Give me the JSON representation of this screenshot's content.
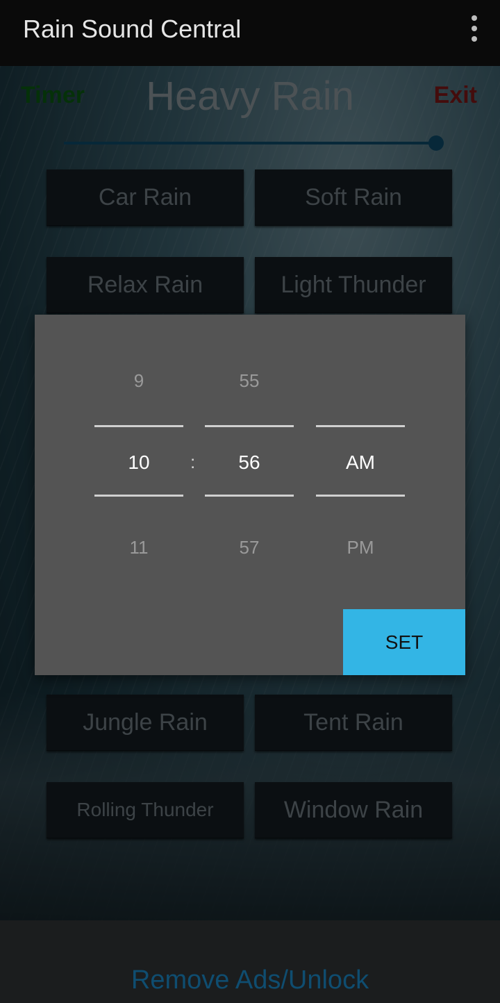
{
  "app_bar": {
    "title": "Rain Sound Central",
    "menu_icon": "more-vert-icon"
  },
  "player": {
    "timer_label": "Timer",
    "current_sound": "Heavy Rain",
    "exit_label": "Exit",
    "volume_fraction": 1.0
  },
  "sounds": [
    "Car Rain",
    "Soft Rain",
    "Relax Rain",
    "Light Thunder",
    "Jungle Rain",
    "Tent Rain",
    "Rolling Thunder",
    "Window Rain"
  ],
  "time_picker": {
    "hour": {
      "prev": "9",
      "selected": "10",
      "next": "11"
    },
    "separator": ":",
    "minute": {
      "prev": "55",
      "selected": "56",
      "next": "57"
    },
    "ampm": {
      "selected": "AM",
      "next": "PM"
    },
    "set_label": "SET"
  },
  "banner": {
    "label": "Remove Ads/Unlock"
  },
  "colors": {
    "timer": "#0a5a12",
    "exit": "#7d1616",
    "set_button": "#33b5e5",
    "banner_text": "#0f4d70",
    "dialog": "#545454"
  }
}
